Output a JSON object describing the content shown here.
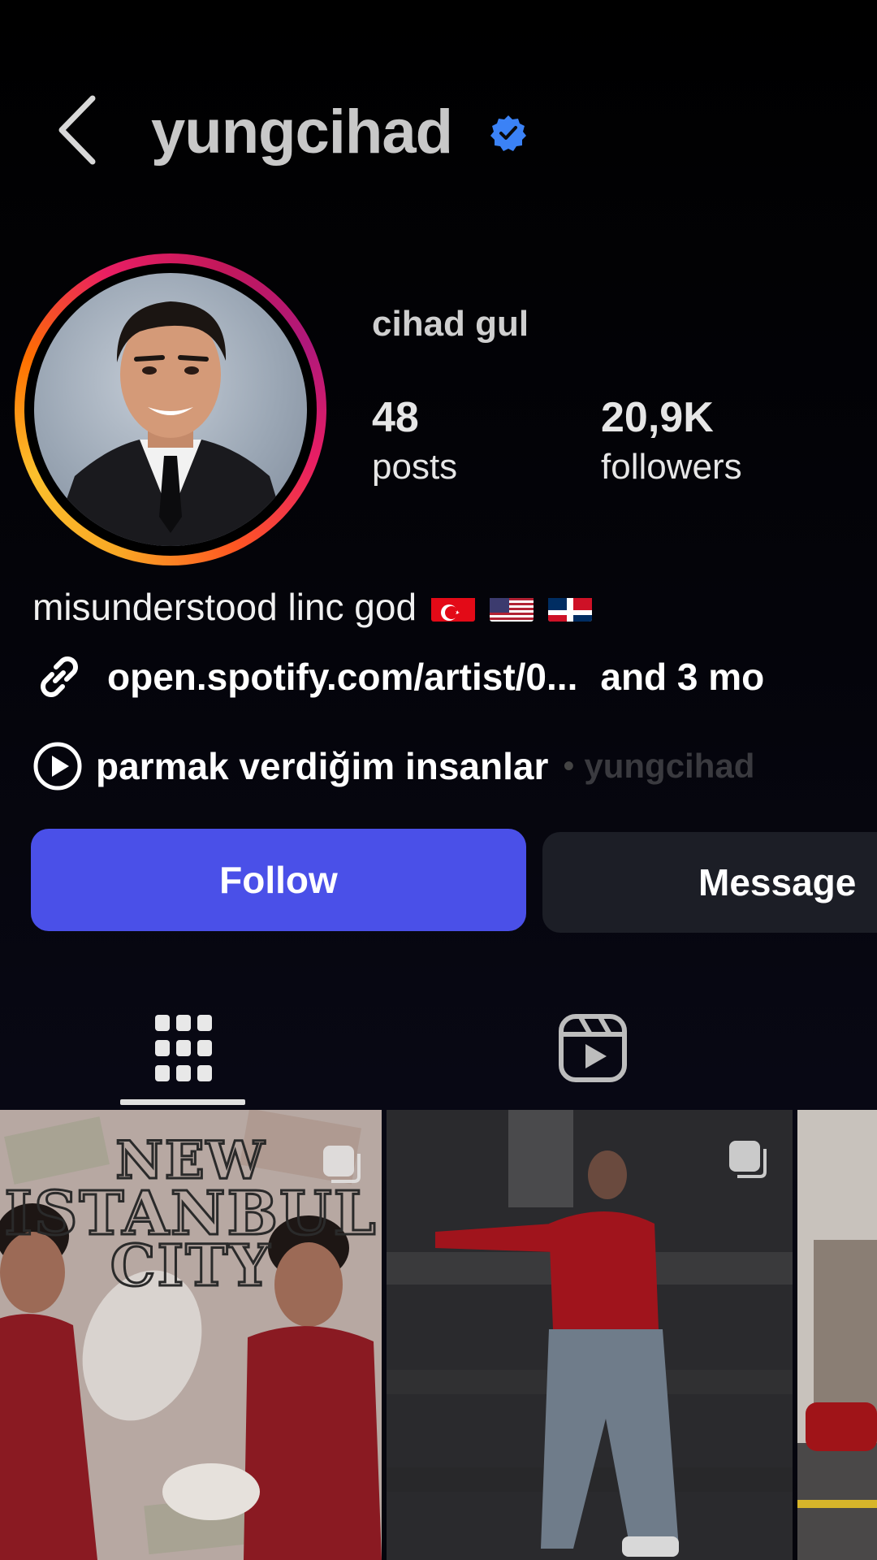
{
  "header": {
    "username": "yungcihad",
    "verified": true,
    "icons": {
      "back": "chevron-left-icon",
      "verified": "verified-badge-icon"
    }
  },
  "profile": {
    "display_name": "cihad gul",
    "stats": {
      "posts_count": "48",
      "posts_label": "posts",
      "followers_count": "20,9K",
      "followers_label": "followers"
    },
    "bio": "misunderstood linc god",
    "flags": [
      "Turkey",
      "United States",
      "Dominican Republic"
    ],
    "link": {
      "text": "open.spotify.com/artist/0...",
      "more": "and 3 mo"
    },
    "playlist": {
      "title": "parmak verdiğim insanlar",
      "separator": "•",
      "owner": "yungcihad"
    }
  },
  "actions": {
    "follow_label": "Follow",
    "message_label": "Message"
  },
  "tabs": [
    {
      "name": "posts-grid",
      "icon": "grid-icon",
      "active": true
    },
    {
      "name": "reels",
      "icon": "reels-icon",
      "active": false
    }
  ],
  "posts": [
    {
      "overlay_text": [
        "NEW",
        "ISTANBUL",
        "CITY"
      ],
      "multi": true
    },
    {
      "overlay_text": [],
      "multi": true
    },
    {
      "overlay_text": [],
      "multi": false
    }
  ],
  "colors": {
    "follow_button": "#4a50e8",
    "message_button": "#1c1e26",
    "verified_badge": "#3b82f6",
    "background": "#000000"
  }
}
